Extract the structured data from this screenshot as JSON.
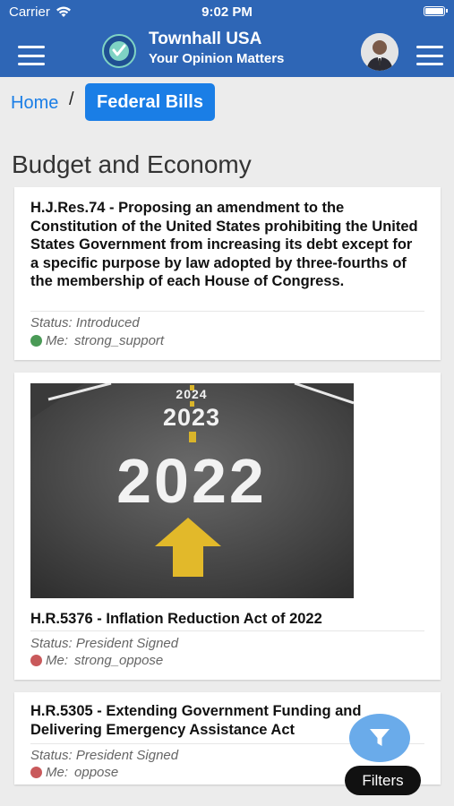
{
  "status_bar": {
    "carrier": "Carrier",
    "time": "9:02 PM"
  },
  "header": {
    "app_title": "Townhall USA",
    "tagline": "Your Opinion Matters",
    "brand_color": "#2e66b6"
  },
  "breadcrumb": {
    "home": "Home",
    "separator": "/",
    "current": "Federal Bills"
  },
  "section": {
    "title": "Budget and Economy"
  },
  "bills": [
    {
      "title": "H.J.Res.74 - Proposing an amendment to the Constitution of the United States prohibiting the United States Government from increasing its debt except for a specific purpose by law adopted by three-fourths of the membership of each House of Congress.",
      "status": "Status: Introduced",
      "me_label": "Me:",
      "me_value": "strong_support",
      "me_color": "#4a9a56"
    },
    {
      "image": {
        "labels": [
          "2024",
          "2023",
          "2022"
        ]
      },
      "title": "H.R.5376 - Inflation Reduction Act of 2022",
      "status": "Status: President Signed",
      "me_label": "Me:",
      "me_value": "strong_oppose",
      "me_color": "#c9595b"
    },
    {
      "title": "H.R.5305 - Extending Government Funding and Delivering Emergency Assistance Act",
      "status": "Status: President Signed",
      "me_label": "Me:",
      "me_value": "oppose",
      "me_color": "#c9595b"
    }
  ],
  "filters": {
    "label": "Filters",
    "fab_color": "#6aabea"
  },
  "icons": {
    "menu_left": "hamburger-menu-icon",
    "menu_right": "hamburger-menu-icon",
    "logo": "townhall-logo-icon",
    "filter": "filter-funnel-icon",
    "wifi": "wifi-icon",
    "battery": "battery-icon"
  }
}
